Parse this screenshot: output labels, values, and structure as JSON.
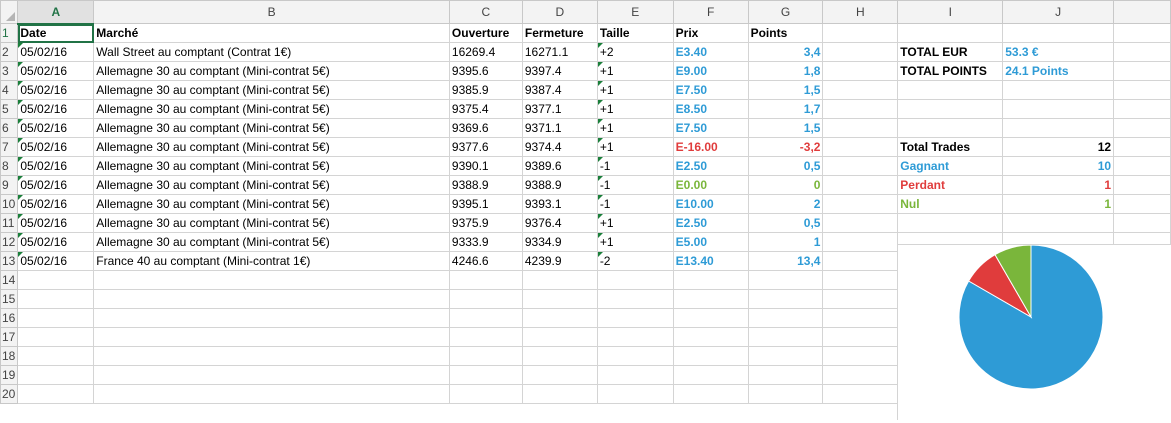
{
  "colors": {
    "blue": "#2e9bd6",
    "red": "#e03c3c",
    "green": "#7ab63b",
    "accent": "#217346"
  },
  "columns": [
    "A",
    "B",
    "C",
    "D",
    "E",
    "F",
    "G",
    "H",
    "I",
    "J",
    ""
  ],
  "row_numbers": [
    "1",
    "2",
    "3",
    "4",
    "5",
    "6",
    "7",
    "8",
    "9",
    "10",
    "11",
    "12",
    "13",
    "14",
    "15",
    "16",
    "17",
    "18",
    "19",
    "20"
  ],
  "headers": {
    "date": "Date",
    "market": "Marché",
    "open": "Ouverture",
    "close": "Fermeture",
    "size": "Taille",
    "price": "Prix",
    "points": "Points"
  },
  "trades": [
    {
      "date": "05/02/16",
      "market": "Wall Street au comptant (Contrat 1€)",
      "open": "16269.4",
      "close": "16271.1",
      "size": "+2",
      "price": "E3.40",
      "points": "3,4",
      "tone": "blue"
    },
    {
      "date": "05/02/16",
      "market": "Allemagne 30 au comptant (Mini-contrat 5€)",
      "open": "9395.6",
      "close": "9397.4",
      "size": "+1",
      "price": "E9.00",
      "points": "1,8",
      "tone": "blue"
    },
    {
      "date": "05/02/16",
      "market": "Allemagne 30 au comptant (Mini-contrat 5€)",
      "open": "9385.9",
      "close": "9387.4",
      "size": "+1",
      "price": "E7.50",
      "points": "1,5",
      "tone": "blue"
    },
    {
      "date": "05/02/16",
      "market": "Allemagne 30 au comptant (Mini-contrat 5€)",
      "open": "9375.4",
      "close": "9377.1",
      "size": "+1",
      "price": "E8.50",
      "points": "1,7",
      "tone": "blue"
    },
    {
      "date": "05/02/16",
      "market": "Allemagne 30 au comptant (Mini-contrat 5€)",
      "open": "9369.6",
      "close": "9371.1",
      "size": "+1",
      "price": "E7.50",
      "points": "1,5",
      "tone": "blue"
    },
    {
      "date": "05/02/16",
      "market": "Allemagne 30 au comptant (Mini-contrat 5€)",
      "open": "9377.6",
      "close": "9374.4",
      "size": "+1",
      "price": "E-16.00",
      "points": "-3,2",
      "tone": "red"
    },
    {
      "date": "05/02/16",
      "market": "Allemagne 30 au comptant (Mini-contrat 5€)",
      "open": "9390.1",
      "close": "9389.6",
      "size": "-1",
      "price": "E2.50",
      "points": "0,5",
      "tone": "blue"
    },
    {
      "date": "05/02/16",
      "market": "Allemagne 30 au comptant (Mini-contrat 5€)",
      "open": "9388.9",
      "close": "9388.9",
      "size": "-1",
      "price": "E0.00",
      "points": "0",
      "tone": "green"
    },
    {
      "date": "05/02/16",
      "market": "Allemagne 30 au comptant (Mini-contrat 5€)",
      "open": "9395.1",
      "close": "9393.1",
      "size": "-1",
      "price": "E10.00",
      "points": "2",
      "tone": "blue"
    },
    {
      "date": "05/02/16",
      "market": "Allemagne 30 au comptant (Mini-contrat 5€)",
      "open": "9375.9",
      "close": "9376.4",
      "size": "+1",
      "price": "E2.50",
      "points": "0,5",
      "tone": "blue"
    },
    {
      "date": "05/02/16",
      "market": "Allemagne 30 au comptant (Mini-contrat 5€)",
      "open": "9333.9",
      "close": "9334.9",
      "size": "+1",
      "price": "E5.00",
      "points": "1",
      "tone": "blue"
    },
    {
      "date": "05/02/16",
      "market": "France 40 au comptant (Mini-contrat 1€)",
      "open": "4246.6",
      "close": "4239.9",
      "size": "-2",
      "price": "E13.40",
      "points": "13,4",
      "tone": "blue"
    }
  ],
  "summary": {
    "total_eur_label": "TOTAL EUR",
    "total_eur_value": "53.3 €",
    "total_points_label": "TOTAL POINTS",
    "total_points_value": "24.1 Points",
    "total_trades_label": "Total Trades",
    "total_trades_value": "12",
    "winning_label": "Gagnant",
    "winning_value": "10",
    "losing_label": "Perdant",
    "losing_value": "1",
    "neutral_label": "Nul",
    "neutral_value": "1"
  },
  "chart_data": {
    "type": "pie",
    "categories": [
      "Gagnant",
      "Perdant",
      "Nul"
    ],
    "values": [
      10,
      1,
      1
    ],
    "colors": [
      "#2e9bd6",
      "#e03c3c",
      "#7ab63b"
    ]
  }
}
